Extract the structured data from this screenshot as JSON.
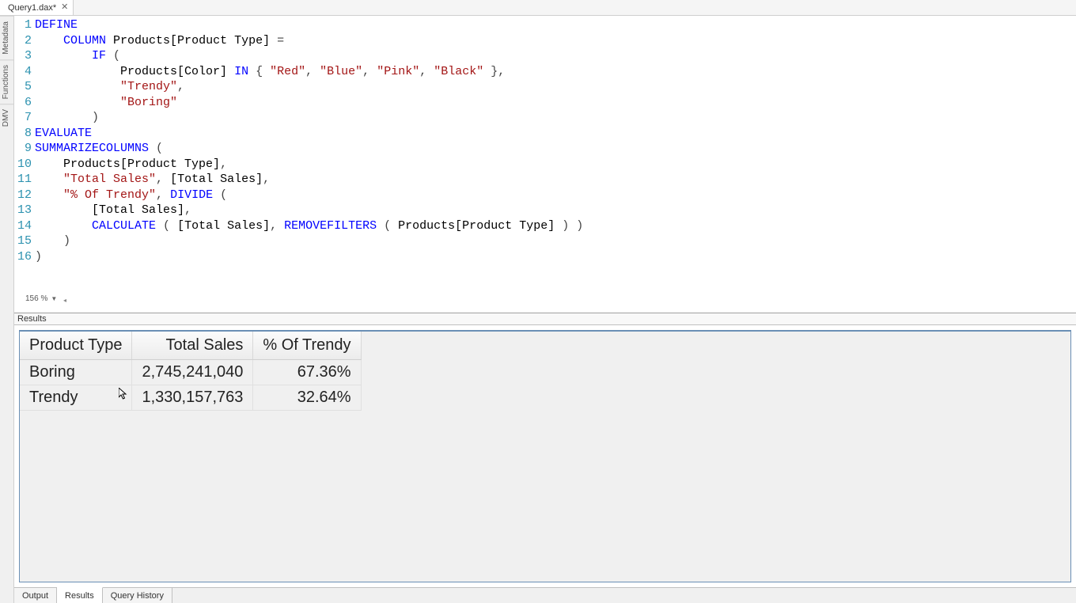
{
  "tab": {
    "title": "Query1.dax*"
  },
  "side_tabs": [
    "Metadata",
    "Functions",
    "DMV"
  ],
  "zoom": {
    "value": "156 %"
  },
  "code": {
    "lines": [
      {
        "n": 1,
        "tokens": [
          [
            "kw",
            "DEFINE"
          ]
        ]
      },
      {
        "n": 2,
        "tokens": [
          [
            "",
            "    "
          ],
          [
            "kw",
            "COLUMN"
          ],
          [
            "",
            " "
          ],
          [
            "id",
            "Products[Product Type]"
          ],
          [
            "",
            " "
          ],
          [
            "op",
            "="
          ]
        ]
      },
      {
        "n": 3,
        "tokens": [
          [
            "",
            "        "
          ],
          [
            "fn",
            "IF"
          ],
          [
            "",
            " "
          ],
          [
            "punct",
            "("
          ]
        ]
      },
      {
        "n": 4,
        "tokens": [
          [
            "",
            "            "
          ],
          [
            "id",
            "Products[Color]"
          ],
          [
            "",
            " "
          ],
          [
            "kw",
            "IN"
          ],
          [
            "",
            " "
          ],
          [
            "punct",
            "{ "
          ],
          [
            "str",
            "\"Red\""
          ],
          [
            "punct",
            ", "
          ],
          [
            "str",
            "\"Blue\""
          ],
          [
            "punct",
            ", "
          ],
          [
            "str",
            "\"Pink\""
          ],
          [
            "punct",
            ", "
          ],
          [
            "str",
            "\"Black\""
          ],
          [
            "punct",
            " },"
          ]
        ]
      },
      {
        "n": 5,
        "tokens": [
          [
            "",
            "            "
          ],
          [
            "str",
            "\"Trendy\""
          ],
          [
            "punct",
            ","
          ]
        ]
      },
      {
        "n": 6,
        "tokens": [
          [
            "",
            "            "
          ],
          [
            "str",
            "\"Boring\""
          ]
        ]
      },
      {
        "n": 7,
        "tokens": [
          [
            "",
            "        "
          ],
          [
            "punct",
            ")"
          ]
        ]
      },
      {
        "n": 8,
        "tokens": [
          [
            "kw",
            "EVALUATE"
          ]
        ]
      },
      {
        "n": 9,
        "tokens": [
          [
            "fn",
            "SUMMARIZECOLUMNS"
          ],
          [
            "",
            " "
          ],
          [
            "punct",
            "("
          ]
        ]
      },
      {
        "n": 10,
        "tokens": [
          [
            "",
            "    "
          ],
          [
            "id",
            "Products[Product Type]"
          ],
          [
            "punct",
            ","
          ]
        ]
      },
      {
        "n": 11,
        "tokens": [
          [
            "",
            "    "
          ],
          [
            "str",
            "\"Total Sales\""
          ],
          [
            "punct",
            ", "
          ],
          [
            "id",
            "[Total Sales]"
          ],
          [
            "punct",
            ","
          ]
        ]
      },
      {
        "n": 12,
        "tokens": [
          [
            "",
            "    "
          ],
          [
            "str",
            "\"% Of Trendy\""
          ],
          [
            "punct",
            ", "
          ],
          [
            "fn",
            "DIVIDE"
          ],
          [
            "",
            " "
          ],
          [
            "punct",
            "("
          ]
        ]
      },
      {
        "n": 13,
        "tokens": [
          [
            "",
            "        "
          ],
          [
            "id",
            "[Total Sales]"
          ],
          [
            "punct",
            ","
          ]
        ]
      },
      {
        "n": 14,
        "tokens": [
          [
            "",
            "        "
          ],
          [
            "fn",
            "CALCULATE"
          ],
          [
            "",
            " "
          ],
          [
            "punct",
            "( "
          ],
          [
            "id",
            "[Total Sales]"
          ],
          [
            "punct",
            ", "
          ],
          [
            "fn",
            "REMOVEFILTERS"
          ],
          [
            "",
            " "
          ],
          [
            "punct",
            "( "
          ],
          [
            "id",
            "Products[Product Type]"
          ],
          [
            "punct",
            " ) )"
          ]
        ]
      },
      {
        "n": 15,
        "tokens": [
          [
            "",
            "    "
          ],
          [
            "punct",
            ")"
          ]
        ]
      },
      {
        "n": 16,
        "tokens": [
          [
            "punct",
            ")"
          ]
        ]
      }
    ]
  },
  "results": {
    "label": "Results",
    "headers": [
      "Product Type",
      "Total Sales",
      "% Of Trendy"
    ],
    "rows": [
      {
        "product_type": "Boring",
        "total_sales": "2,745,241,040",
        "pct": "67.36%"
      },
      {
        "product_type": "Trendy",
        "total_sales": "1,330,157,763",
        "pct": "32.64%"
      }
    ]
  },
  "bottom_tabs": {
    "items": [
      "Output",
      "Results",
      "Query History"
    ],
    "active_index": 1
  }
}
